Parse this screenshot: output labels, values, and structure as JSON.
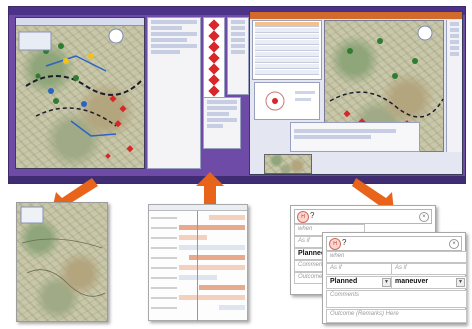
{
  "colors": {
    "accent_arrow": "#e8641b",
    "app_frame": "#6f4ba8",
    "symbol_red": "#d8262b",
    "selection": "#f6c089"
  },
  "forms": {
    "back": {
      "title": "?",
      "who": "",
      "when": "when",
      "field_a": "As if",
      "planned": "Plannec",
      "comments": "Comment",
      "outcome": "Outcome"
    },
    "front": {
      "title": "?",
      "who": "",
      "when": "when",
      "as_if_1": "As if",
      "as_if_2": "As if",
      "status": "Planned",
      "kind": "maneuver",
      "comments": "Comments",
      "outcome": "Outcome (Remarks) Here"
    }
  }
}
